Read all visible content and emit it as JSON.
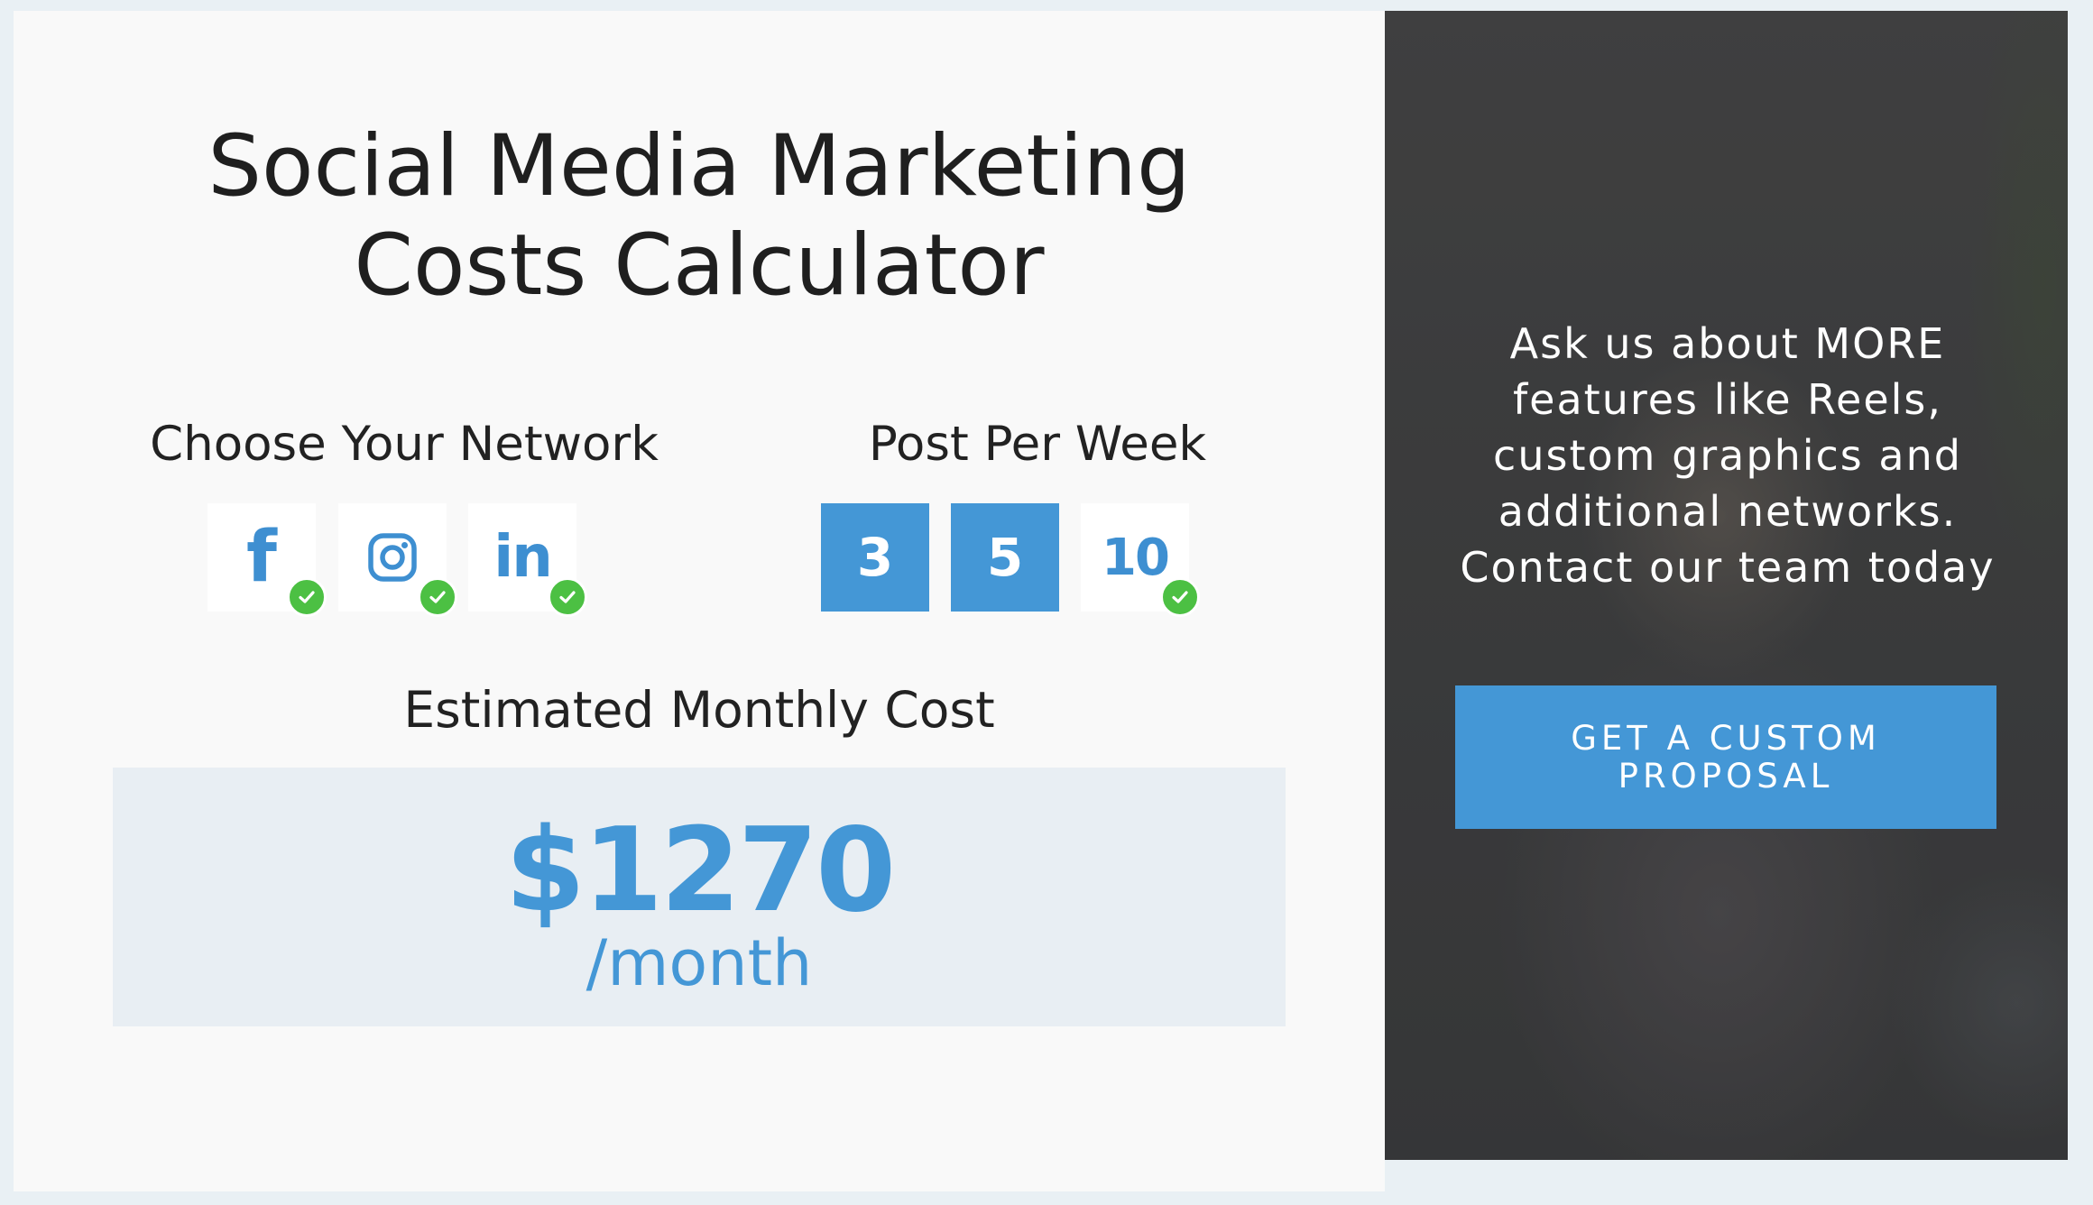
{
  "calculator": {
    "title_line1": "Social Media Marketing",
    "title_line2": "Costs Calculator",
    "network_label": "Choose Your Network",
    "posts_label": "Post Per Week",
    "networks": [
      {
        "name": "Facebook",
        "icon": "facebook-icon",
        "glyph": "f",
        "selected": true
      },
      {
        "name": "Instagram",
        "icon": "instagram-icon",
        "selected": true
      },
      {
        "name": "LinkedIn",
        "icon": "linkedin-icon",
        "glyph": "in",
        "selected": true
      }
    ],
    "post_options": [
      {
        "label": "3",
        "selected": false
      },
      {
        "label": "5",
        "selected": false
      },
      {
        "label": "10",
        "selected": true
      }
    ],
    "cost_label": "Estimated Monthly Cost",
    "cost_amount": "$1270",
    "cost_period": "/month"
  },
  "promo": {
    "text": "Ask us about MORE features like Reels, custom graphics and additional networks. Contact our team today",
    "cta_label": "GET A CUSTOM PROPOSAL"
  },
  "colors": {
    "accent": "#4497d6",
    "check": "#4cc043",
    "panel_bg": "#f9f9f9",
    "cost_box_bg": "#e8eef3"
  }
}
